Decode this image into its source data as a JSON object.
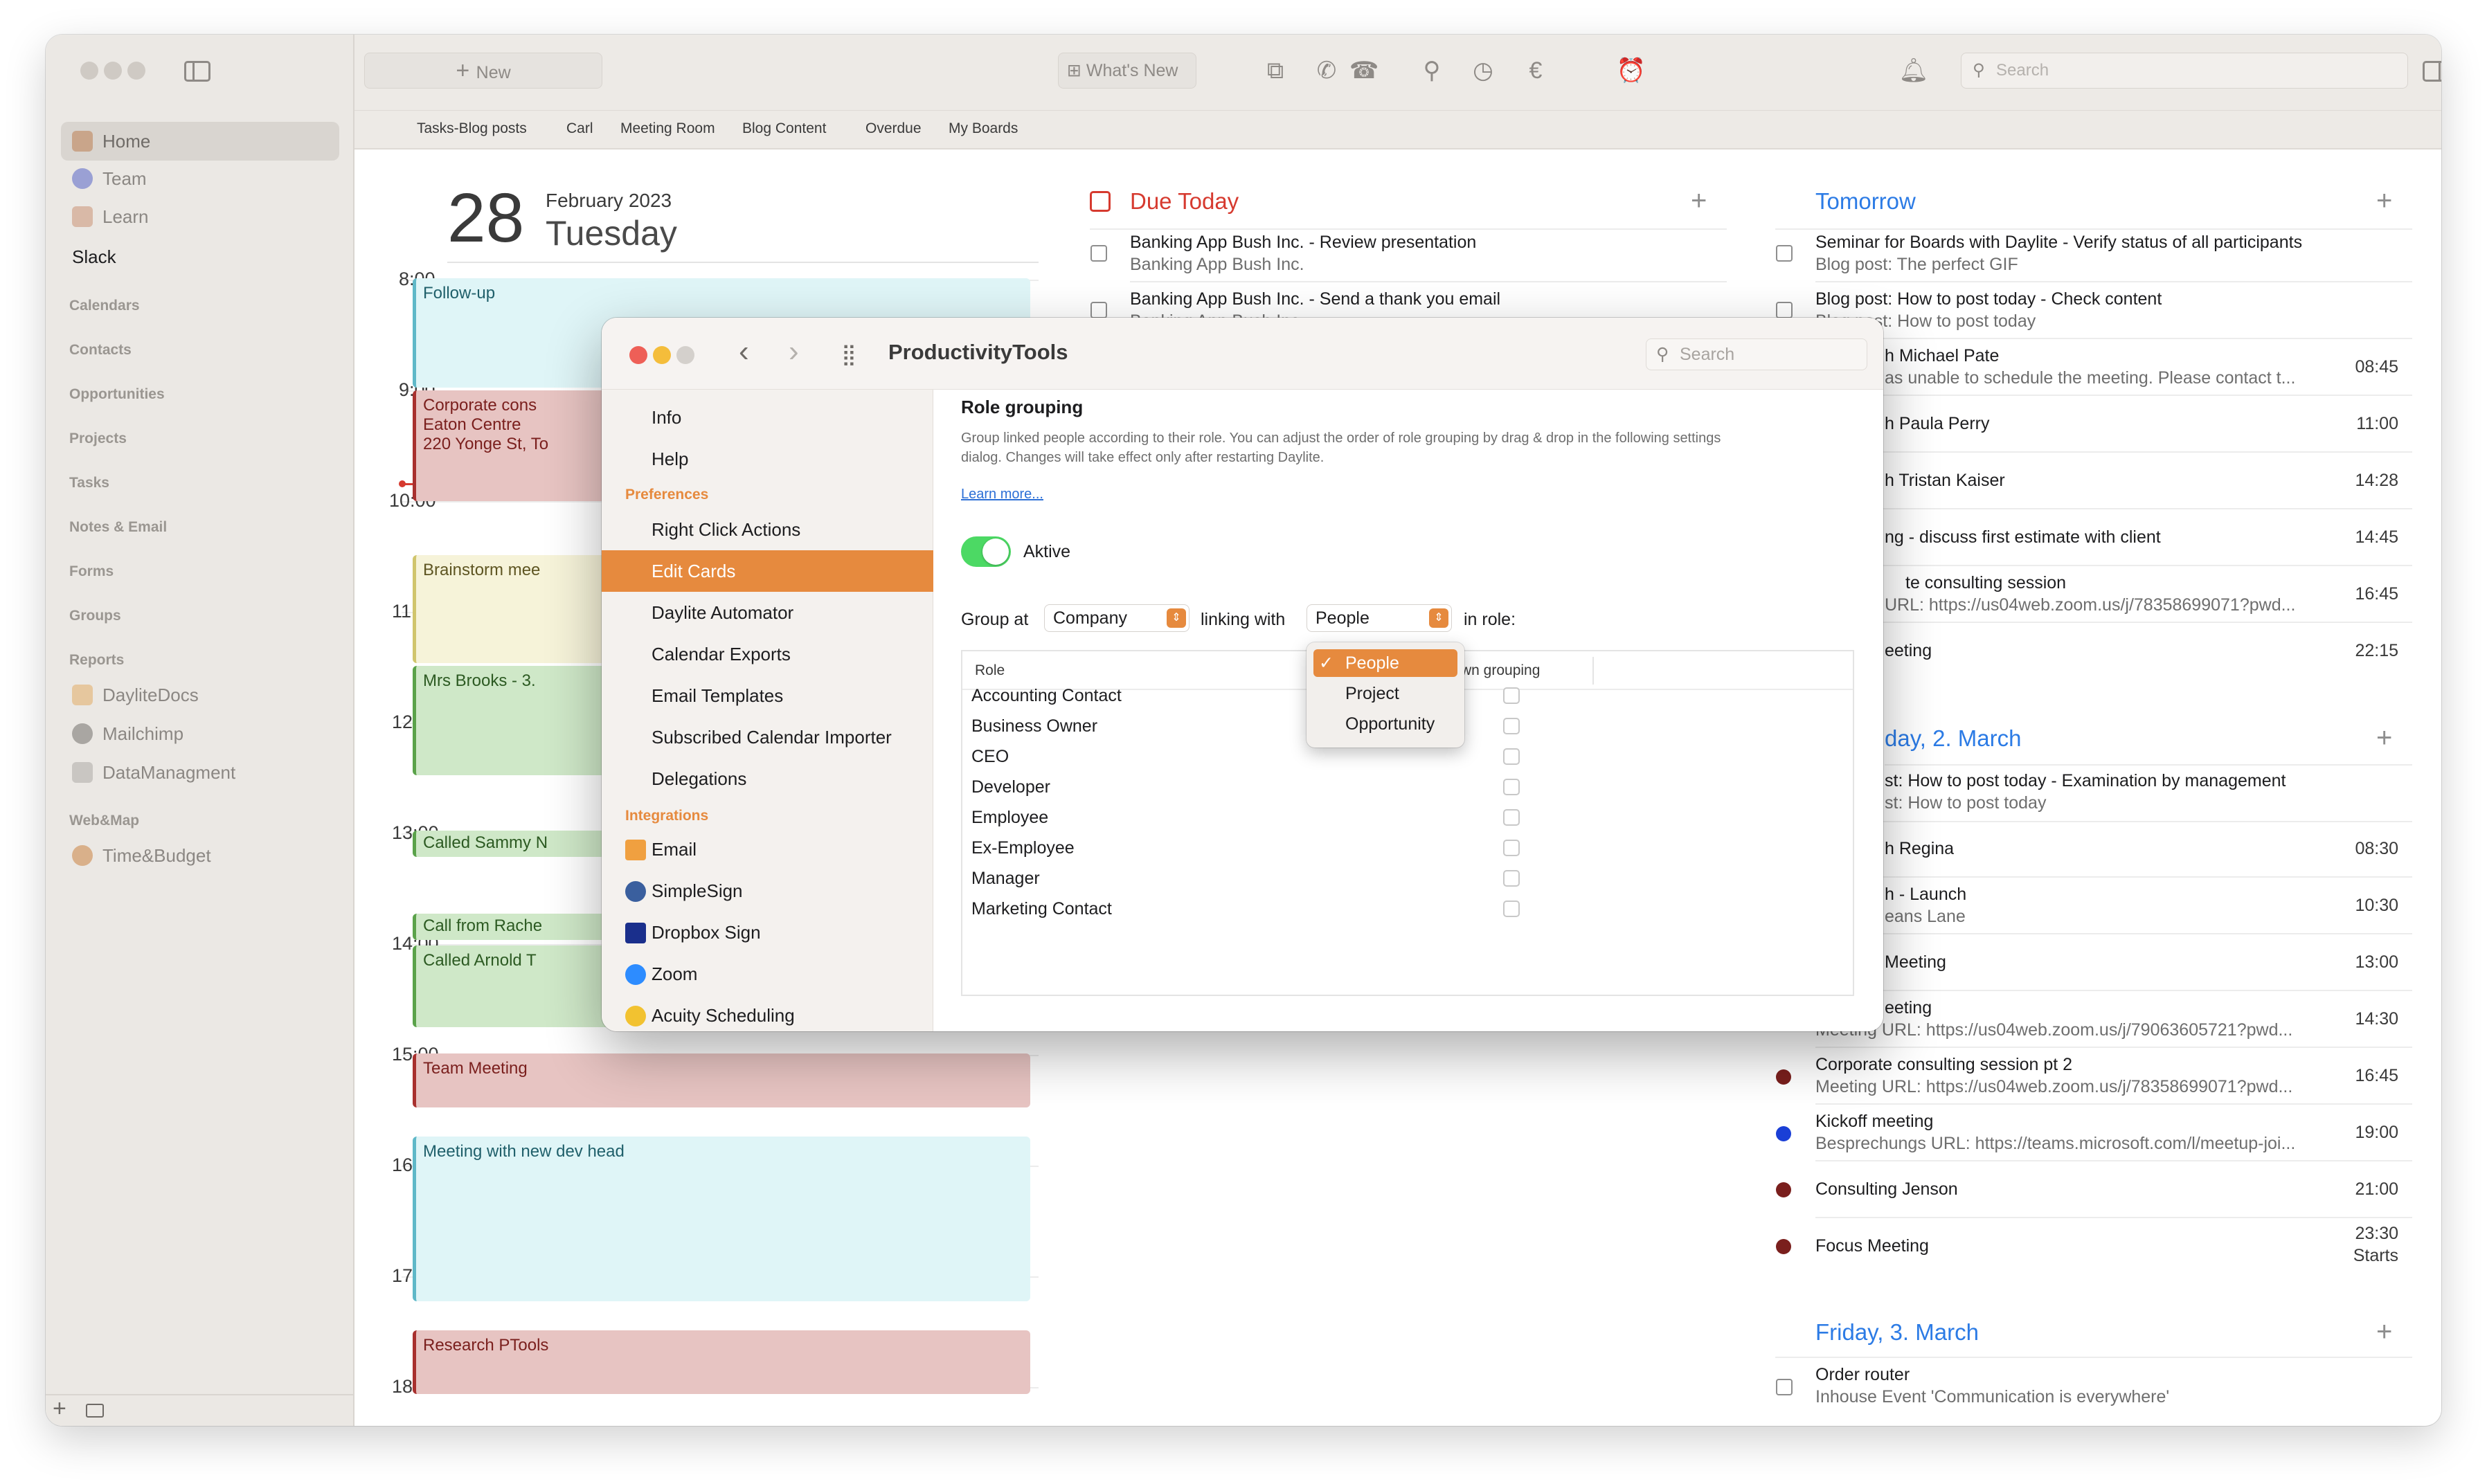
{
  "colors": {
    "accent": "#e68a3e",
    "link_blue": "#2c7be5",
    "due_red": "#d63a2f",
    "toggle_green": "#4cd964"
  },
  "sidebar": {
    "items": [
      {
        "label": "Home",
        "icon": "home-icon"
      },
      {
        "label": "Team",
        "icon": "team-icon"
      },
      {
        "label": "Learn",
        "icon": "learn-icon"
      }
    ],
    "slack": "Slack",
    "sections": [
      "Calendars",
      "Contacts",
      "Opportunities",
      "Projects",
      "Tasks",
      "Notes & Email",
      "Forms",
      "Groups",
      "Reports"
    ],
    "report_items": [
      "DayliteDocs",
      "Mailchimp",
      "DataManagment"
    ],
    "webmap_section": "Web&Map",
    "webmap_items": [
      "Time&Budget"
    ]
  },
  "toolbar": {
    "new_label": "New",
    "whats_new": "What's New",
    "search_placeholder": "Search"
  },
  "bookmarks": [
    "Tasks-Blog posts",
    "Carl",
    "Meeting Room",
    "Blog Content",
    "Overdue",
    "My Boards"
  ],
  "day": {
    "date_num": "28",
    "month_year": "February 2023",
    "weekday": "Tuesday",
    "hours": [
      "8:00",
      "9:00",
      "10:00",
      "11:00",
      "12:00",
      "13:00",
      "14:00",
      "15:00",
      "16:00",
      "17:00",
      "18:00"
    ],
    "events": [
      {
        "title": "Follow-up"
      },
      {
        "title": "Corporate cons",
        "line2": "Eaton Centre",
        "line3": "220 Yonge St, To"
      },
      {
        "title": "Brainstorm mee"
      },
      {
        "title": "Mrs Brooks - 3."
      },
      {
        "title": "Called Sammy N"
      },
      {
        "title": "Call from Rache"
      },
      {
        "title": "Called Arnold T"
      },
      {
        "title": "Team Meeting"
      },
      {
        "title": "Meeting with new dev head"
      },
      {
        "title": "Research PTools"
      }
    ]
  },
  "due_today": {
    "title": "Due Today",
    "tasks": [
      {
        "title": "Banking App Bush Inc. - Review presentation",
        "sub": "Banking App Bush Inc."
      },
      {
        "title": "Banking App Bush Inc. - Send a thank you email",
        "sub": "Banking App Bush Inc."
      }
    ]
  },
  "tomorrow": {
    "title": "Tomorrow",
    "rows": [
      {
        "title": "Seminar for Boards with Daylite - Verify status of all participants",
        "sub": "Blog post: The perfect GIF",
        "time": ""
      },
      {
        "title": "Blog post: How to post today - Check content",
        "sub": "Blog post: How to post today",
        "time": ""
      },
      {
        "title": "h Michael Pate",
        "sub": "as unable to schedule the meeting.  Please contact t...",
        "time": "08:45"
      },
      {
        "title": "h Paula Perry",
        "sub": "",
        "time": "11:00"
      },
      {
        "title": "h Tristan Kaiser",
        "sub": "",
        "time": "14:28"
      },
      {
        "title": "ng - discuss first estimate with client",
        "sub": "",
        "time": "14:45"
      },
      {
        "title": "te consulting session",
        "sub": "URL: https://us04web.zoom.us/j/78358699071?pwd...",
        "time": "16:45"
      },
      {
        "title": "eeting",
        "sub": "",
        "time": "22:15"
      }
    ]
  },
  "thursday": {
    "title": "day, 2. March",
    "rows": [
      {
        "title": "st: How to post today - Examination by management",
        "sub": "st: How to post today",
        "time": ""
      },
      {
        "title": "h Regina",
        "sub": "",
        "time": "08:30"
      },
      {
        "title": "h - Launch",
        "sub": "eans Lane",
        "time": "10:30"
      },
      {
        "title": "Meeting",
        "sub": "",
        "time": "13:00"
      },
      {
        "title": "eeting",
        "sub": "Meeting URL: https://us04web.zoom.us/j/79063605721?pwd...",
        "time": "14:30"
      },
      {
        "title": "Corporate consulting session pt 2",
        "sub": "Meeting URL: https://us04web.zoom.us/j/78358699071?pwd...",
        "time": "16:45"
      },
      {
        "title": "Kickoff meeting",
        "sub": "Besprechungs URL: https://teams.microsoft.com/l/meetup-joi...",
        "time": "19:00"
      },
      {
        "title": "Consulting Jenson",
        "sub": "",
        "time": "21:00"
      },
      {
        "title": "Focus Meeting",
        "sub": "",
        "time": "23:30",
        "time2": "Starts"
      }
    ]
  },
  "friday": {
    "title": "Friday, 3. March",
    "rows": [
      {
        "title": "Order router",
        "sub": "Inhouse Event 'Communication is everywhere'"
      }
    ]
  },
  "prefs": {
    "title": "ProductivityTools",
    "search_placeholder": "Search",
    "top_items": [
      "Info",
      "Help"
    ],
    "preferences_section": "Preferences",
    "pref_items": [
      "Right Click Actions",
      "Edit Cards",
      "Daylite Automator",
      "Calendar Exports",
      "Email Templates",
      "Subscribed Calendar Importer",
      "Delegations"
    ],
    "selected_item": "Edit Cards",
    "integrations_section": "Integrations",
    "integration_items": [
      "Email",
      "SimpleSign",
      "Dropbox Sign",
      "Zoom",
      "Acuity Scheduling"
    ],
    "content": {
      "heading": "Role grouping",
      "description": "Group linked people according to their role. You can adjust the order of role grouping by drag & drop in the following settings dialog. Changes will take effect only after restarting Daylite.",
      "learn_more": "Learn more...",
      "toggle_label": "Aktive",
      "toggle_on": true,
      "group_at_label": "Group at",
      "group_at_value": "Company",
      "linking_with_label": "linking with",
      "linking_with_value": "People",
      "in_role_label": "in role:",
      "table_header_role": "Role",
      "table_header_own": "wn grouping",
      "roles": [
        "Accounting Contact",
        "Business Owner",
        "CEO",
        "Developer",
        "Employee",
        "Ex-Employee",
        "Manager",
        "Marketing Contact"
      ]
    },
    "dropdown": {
      "options": [
        "People",
        "Project",
        "Opportunity"
      ],
      "selected": "People"
    }
  }
}
